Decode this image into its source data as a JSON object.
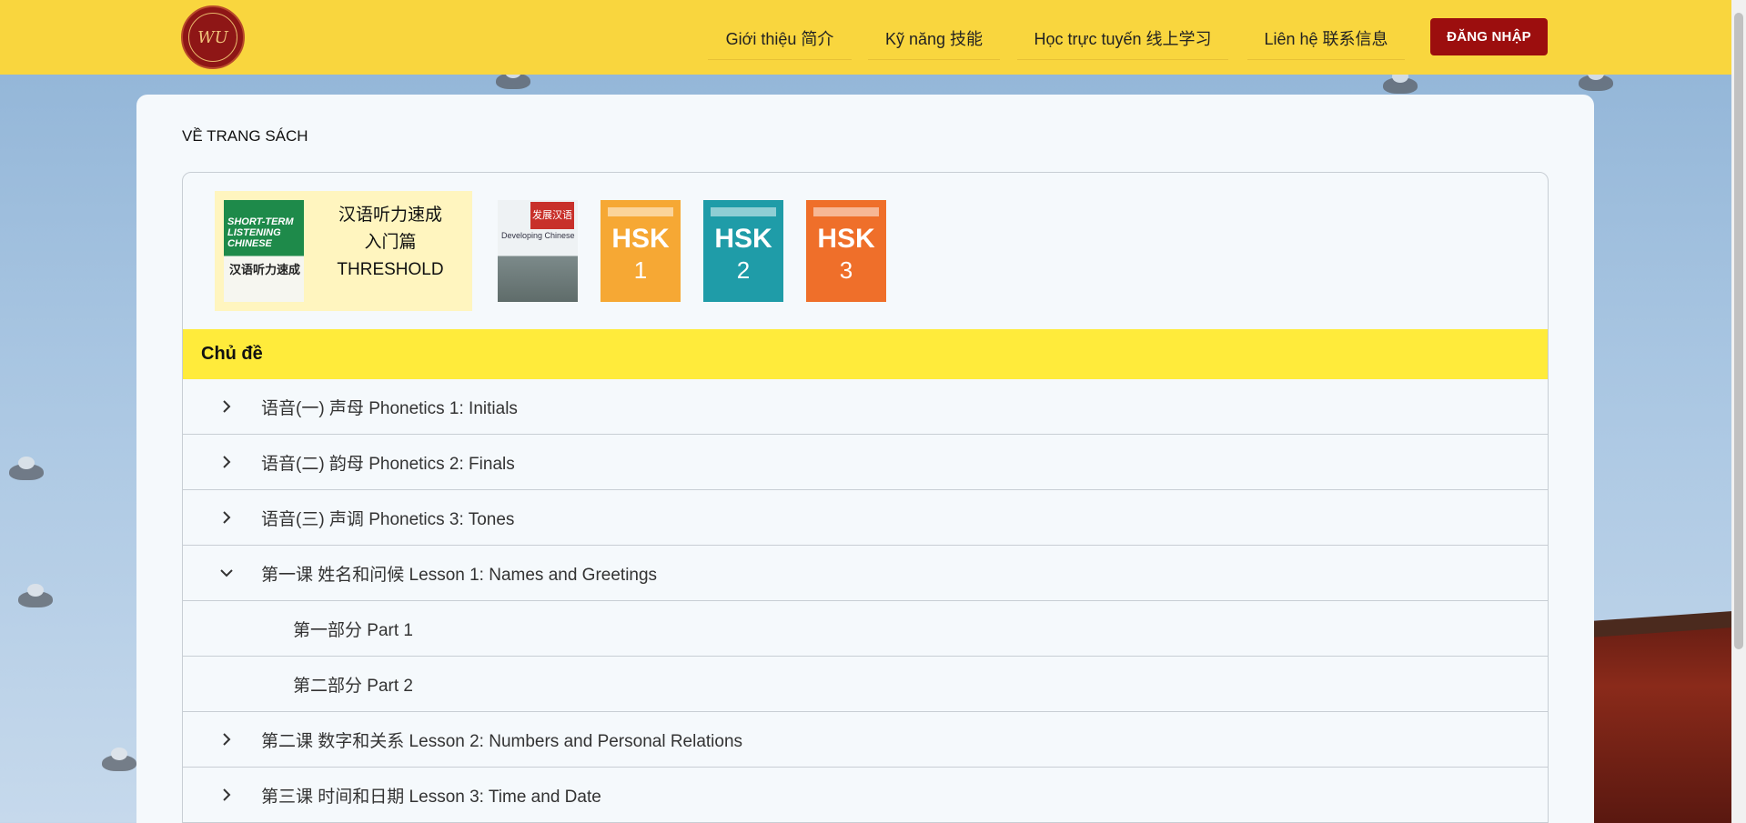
{
  "header": {
    "logo_text": "WU",
    "nav": [
      {
        "label": "Giới thiệu 简介"
      },
      {
        "label": "Kỹ năng 技能"
      },
      {
        "label": "Học trực tuyến 线上学习"
      },
      {
        "label": "Liên hệ 联系信息"
      }
    ],
    "login_label": "ĐĂNG NHẬP"
  },
  "main": {
    "section_title": "VỀ TRANG SÁCH",
    "selected_book": {
      "cover_title": "SHORT-TERM LISTENING CHINESE",
      "cover_subtitle": "汉语听力速成",
      "line1": "汉语听力速成",
      "line2": "入门篇",
      "line3": "THRESHOLD"
    },
    "books": [
      {
        "name": "发展汉语",
        "cover_label": "Developing Chinese"
      },
      {
        "name": "HSK 1",
        "hsk": "HSK",
        "num": "1"
      },
      {
        "name": "HSK 2",
        "hsk": "HSK",
        "num": "2"
      },
      {
        "name": "HSK 3",
        "hsk": "HSK",
        "num": "3"
      }
    ],
    "topic_header": "Chủ đề",
    "topics": [
      {
        "label": "语音(一) 声母 Phonetics 1: Initials",
        "expanded": false
      },
      {
        "label": "语音(二) 韵母 Phonetics 2: Finals",
        "expanded": false
      },
      {
        "label": "语音(三) 声调 Phonetics 3: Tones",
        "expanded": false
      },
      {
        "label": "第一课 姓名和问候 Lesson 1: Names and Greetings",
        "expanded": true
      },
      {
        "label": "第一部分 Part 1",
        "sub": true
      },
      {
        "label": "第二部分 Part 2",
        "sub": true
      },
      {
        "label": "第二课 数字和关系 Lesson 2: Numbers and Personal Relations",
        "expanded": false
      },
      {
        "label": "第三课 时间和日期 Lesson 3: Time and Date",
        "expanded": false
      }
    ]
  },
  "colors": {
    "header_bg": "#f9d63e",
    "login_bg": "#9c0e0e",
    "topic_header_bg": "#ffeb3b",
    "selected_book_bg": "#fff5bf"
  }
}
